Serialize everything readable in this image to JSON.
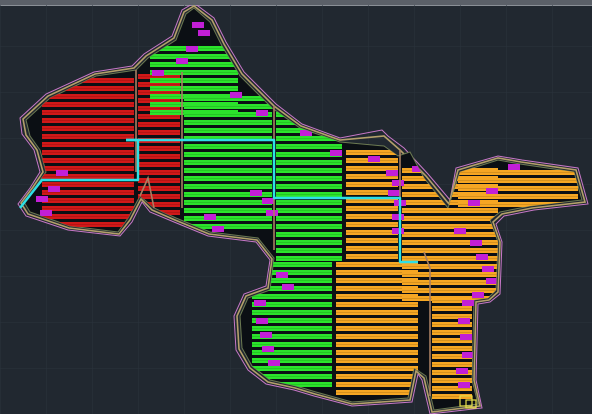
{
  "app": {
    "view": "cad-model-space"
  },
  "colors": {
    "background": "#212830",
    "grid": "#2b333d",
    "outline_outer": "#c878c8",
    "outline_mid": "#b4a06a",
    "boundary_dark": "#0b0f14",
    "zone_red": "#d11818",
    "zone_green": "#2be32b",
    "zone_orange": "#f5a623",
    "combiner_magenta": "#c21fd6",
    "cable_cyan": "#2de0e6",
    "divider_tan": "#a87f62",
    "inverter_box": "#e8e04a"
  },
  "zones": [
    {
      "id": "red",
      "color_key": "zone_red"
    },
    {
      "id": "green",
      "color_key": "zone_green"
    },
    {
      "id": "orange",
      "color_key": "zone_orange"
    }
  ]
}
